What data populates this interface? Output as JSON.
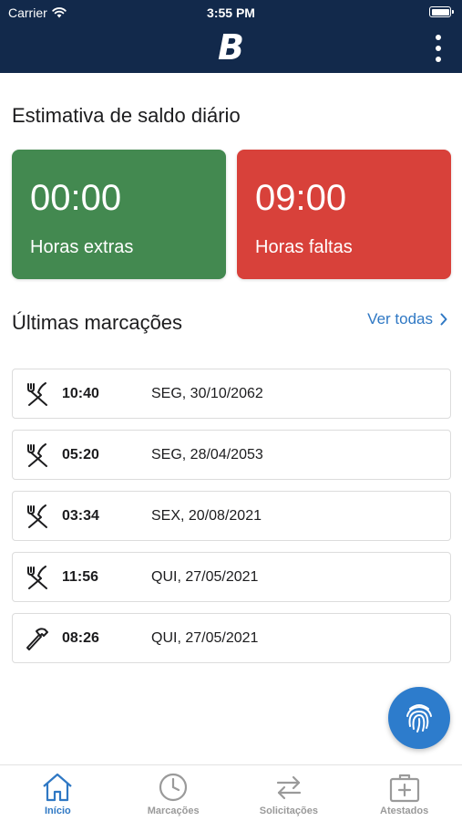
{
  "status_bar": {
    "carrier": "Carrier",
    "time": "3:55 PM"
  },
  "header": {
    "logo": "B"
  },
  "saldo": {
    "title": "Estimativa de saldo diário",
    "extras": {
      "value": "00:00",
      "label": "Horas extras",
      "color": "#438950"
    },
    "faltas": {
      "value": "09:00",
      "label": "Horas faltas",
      "color": "#d8413a"
    }
  },
  "marcacoes": {
    "title": "Últimas marcações",
    "see_all": "Ver todas",
    "items": [
      {
        "icon": "fork-knife-icon",
        "time": "10:40",
        "date": "SEG, 30/10/2062"
      },
      {
        "icon": "fork-knife-icon",
        "time": "05:20",
        "date": "SEG, 28/04/2053"
      },
      {
        "icon": "fork-knife-icon",
        "time": "03:34",
        "date": "SEX, 20/08/2021"
      },
      {
        "icon": "fork-knife-icon",
        "time": "11:56",
        "date": "QUI, 27/05/2021"
      },
      {
        "icon": "hammer-icon",
        "time": "08:26",
        "date": "QUI, 27/05/2021"
      }
    ]
  },
  "fab": {
    "icon": "fingerprint-icon",
    "color": "#2d7ccc"
  },
  "tabs": [
    {
      "label": "Início",
      "icon": "home-icon",
      "active": true
    },
    {
      "label": "Marcações",
      "icon": "clock-icon",
      "active": false
    },
    {
      "label": "Solicitações",
      "icon": "swap-arrows-icon",
      "active": false
    },
    {
      "label": "Atestados",
      "icon": "medical-kit-icon",
      "active": false
    }
  ],
  "colors": {
    "header_bg": "#12294b",
    "accent": "#2f78c4",
    "inactive": "#9a9a9a"
  }
}
